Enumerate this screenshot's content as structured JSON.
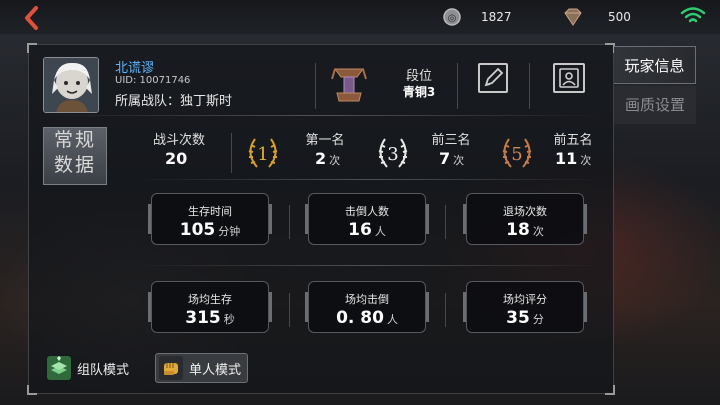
{
  "topbar": {
    "gold": "1827",
    "diamond": "500",
    "icons": {
      "back": "back-arrow-icon",
      "gold": "gold-coin-icon",
      "diamond": "diamond-icon",
      "wifi": "wifi-icon"
    },
    "colors": {
      "back": "#e0503a",
      "wifi": "#2ecc71"
    }
  },
  "player": {
    "name": "北谎谬",
    "uid": "UID: 10071746",
    "team_label": "所属战队：",
    "team_name": "独丁斯时"
  },
  "rank": {
    "label": "段位",
    "value": "青铜3"
  },
  "category_tag": [
    "常规",
    "数据"
  ],
  "summary": {
    "battles": {
      "label": "战斗次数",
      "value": "20"
    },
    "first": {
      "label": "第一名",
      "value": "2",
      "unit": "次",
      "medal": "1"
    },
    "top3": {
      "label": "前三名",
      "value": "7",
      "unit": "次",
      "medal": "3"
    },
    "top5": {
      "label": "前五名",
      "value": "11",
      "unit": "次",
      "medal": "5"
    }
  },
  "stats": [
    {
      "label": "生存时间",
      "value": "105",
      "unit": "分钟"
    },
    {
      "label": "击倒人数",
      "value": "16",
      "unit": "人"
    },
    {
      "label": "退场次数",
      "value": "18",
      "unit": "次"
    },
    {
      "label": "场均生存",
      "value": "315",
      "unit": "秒"
    },
    {
      "label": "场均击倒",
      "value": "0. 80",
      "unit": "人"
    },
    {
      "label": "场均评分",
      "value": "35",
      "unit": "分"
    }
  ],
  "modes": {
    "team": "组队模式",
    "solo": "单人模式"
  },
  "tabs": {
    "player_info": "玩家信息",
    "graphics": "画质设置"
  }
}
